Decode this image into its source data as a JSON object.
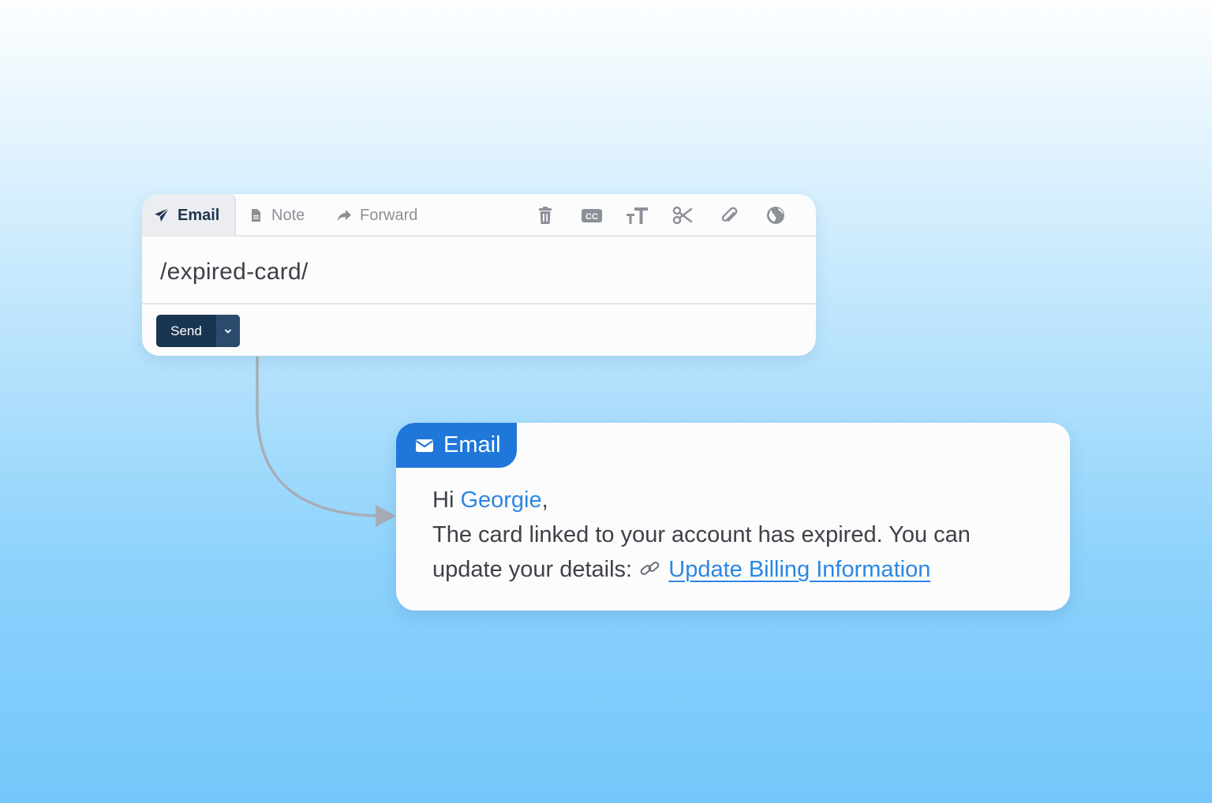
{
  "composer": {
    "tabs": [
      {
        "label": "Email",
        "icon": "send-icon",
        "active": true
      },
      {
        "label": "Note",
        "icon": "document-icon",
        "active": false
      },
      {
        "label": "Forward",
        "icon": "forward-icon",
        "active": false
      }
    ],
    "toolbar_icons": [
      "trash-icon",
      "cc-icon",
      "text-size-icon",
      "scissors-icon",
      "paperclip-icon",
      "globe-icon"
    ],
    "input_value": "/expired-card/",
    "send_label": "Send"
  },
  "email_card": {
    "badge_label": "Email",
    "greeting": "Hi",
    "recipient_name": "Georgie",
    "greeting_suffix": ",",
    "body_line1": "The card linked to your account has expired. You can",
    "body_line2": "update your details:",
    "link_text": "Update Billing Information"
  },
  "colors": {
    "accent_blue": "#1f77da",
    "link_blue": "#2c86e3",
    "send_button": "#1a3552",
    "connector": "#a7adb6"
  }
}
